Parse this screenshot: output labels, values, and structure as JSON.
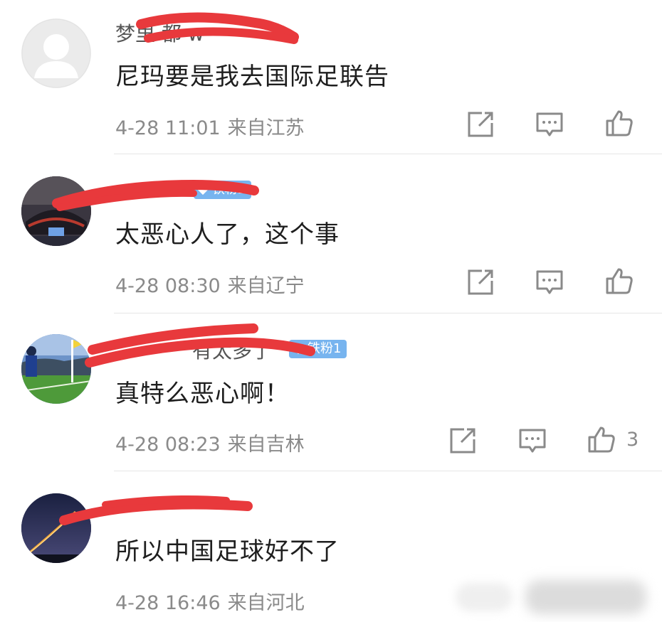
{
  "comments": [
    {
      "username": "梦里 都 w",
      "badge": "",
      "text": "尼玛要是我去国际足联告",
      "date": "4-28 11:01",
      "location": "来自江苏",
      "likes": ""
    },
    {
      "username": "",
      "badge": "铁粉2",
      "text": "太恶心人了，这个事",
      "date": "4-28 08:30",
      "location": "来自辽宁",
      "likes": ""
    },
    {
      "username": "有太多了",
      "badge": "铁粉1",
      "text": "真特么恶心啊！",
      "date": "4-28 08:23",
      "location": "来自吉林",
      "likes": "3"
    },
    {
      "username": "",
      "badge": "",
      "text": "所以中国足球好不了",
      "date": "4-28 16:46",
      "location": "来自河北",
      "likes": ""
    }
  ],
  "icons": {
    "share": "share-icon",
    "reply": "comment-icon",
    "like": "thumbs-up-icon"
  },
  "colors": {
    "scribble": "#e8393c",
    "badge": "#77b4ef",
    "meta": "#8a8a8a"
  }
}
